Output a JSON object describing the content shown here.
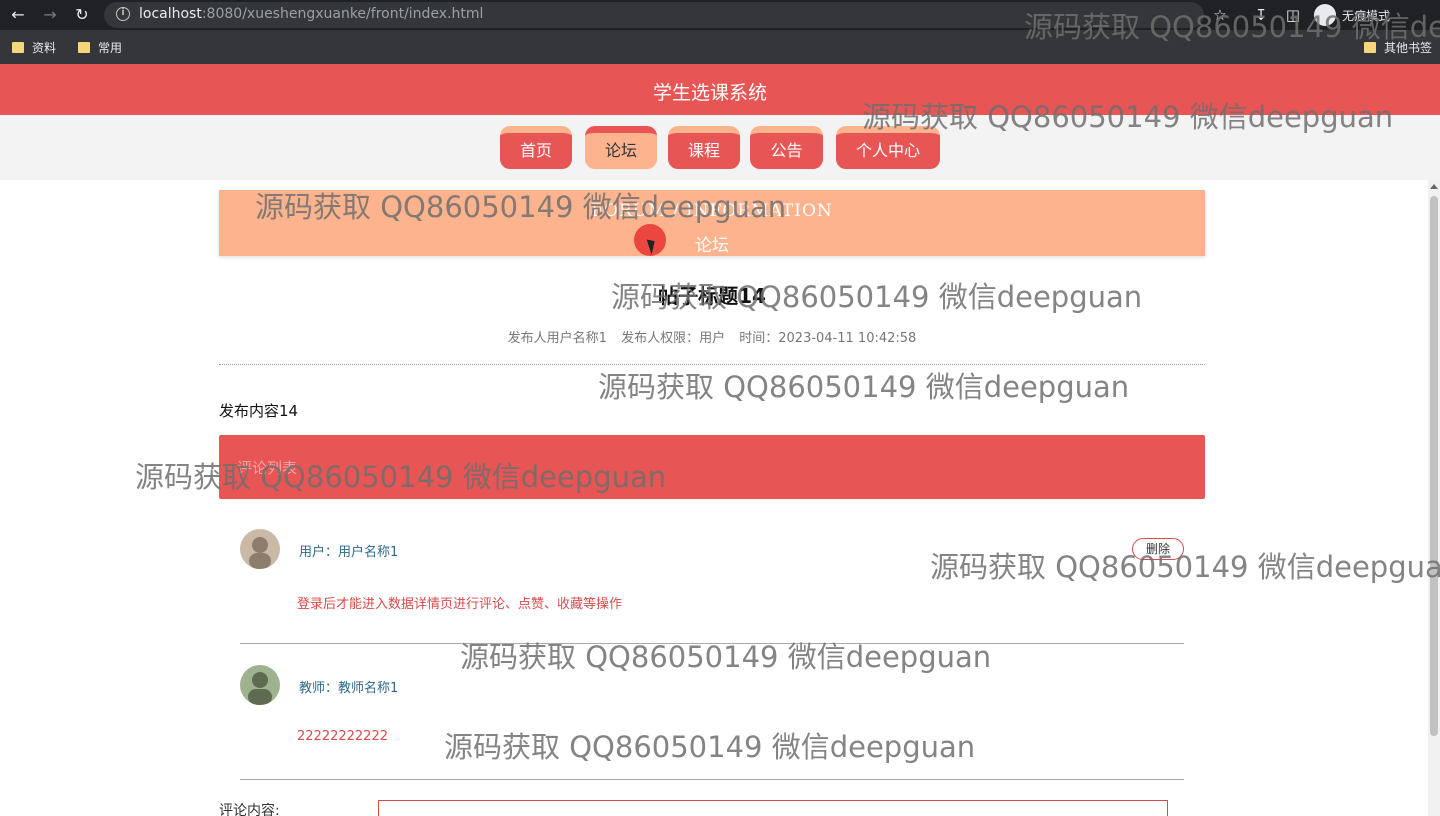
{
  "browser": {
    "url_host": "localhost",
    "url_rest": ":8080/xueshengxuanke/front/index.html",
    "incognito_label": "无痕模式",
    "bookmarks": [
      {
        "label": "资料"
      },
      {
        "label": "常用"
      }
    ],
    "other_bookmarks": "其他书签"
  },
  "site": {
    "title": "学生选课系统",
    "nav": [
      {
        "label": "首页"
      },
      {
        "label": "论坛"
      },
      {
        "label": "课程"
      },
      {
        "label": "公告"
      },
      {
        "label": "个人中心"
      }
    ],
    "active_nav": "论坛"
  },
  "banner": {
    "en": "FORUM / INFORMATION",
    "cn": "论坛"
  },
  "post": {
    "title": "帖子标题14",
    "author": "发布人用户名称1",
    "permission": "发布人权限：用户",
    "time": "时间：2023-04-11 10:42:58",
    "body": "发布内容14"
  },
  "comments_bar": {
    "label": "评论列表"
  },
  "comments": [
    {
      "user": "用户：用户名称1",
      "text": "登录后才能进入数据详情页进行评论、点赞、收藏等操作",
      "delete_label": "删除",
      "avatar_colors": [
        "#cbb9a8",
        "#8d7d6c"
      ]
    },
    {
      "user": "教师：教师名称1",
      "text": "22222222222",
      "avatar_colors": [
        "#9fb28f",
        "#5e6b51"
      ]
    }
  ],
  "comment_form": {
    "label": "评论内容:"
  },
  "watermark": {
    "text": "源码获取 QQ86050149 微信deepguan"
  },
  "colors": {
    "primary": "#e85555",
    "accent": "#fdb48e"
  }
}
